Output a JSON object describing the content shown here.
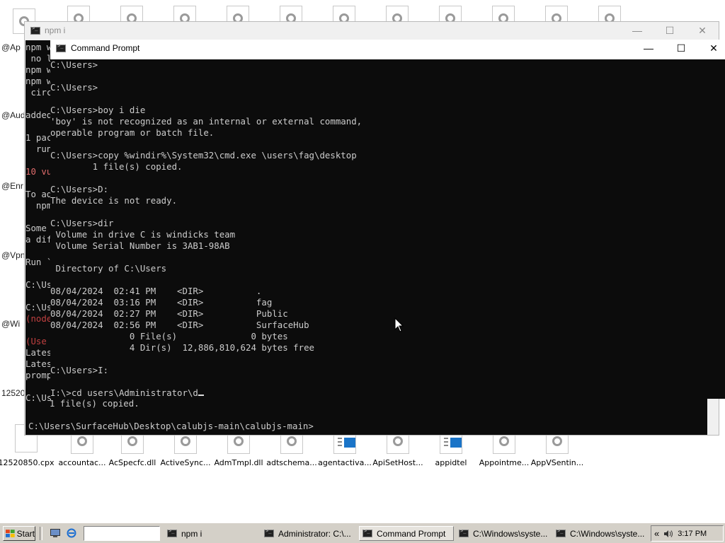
{
  "desktop": {
    "top_icon_count": 11,
    "left_labels": [
      "@Ap",
      "@Aud",
      "@Enr",
      "@Vpn",
      "@Wi",
      "12520/"
    ],
    "bottom_icons": [
      {
        "label": "12520850.cpx",
        "icon": "blank-file-icon"
      },
      {
        "label": "accountac...",
        "icon": "gear-file-icon"
      },
      {
        "label": "AcSpecfc.dll",
        "icon": "gear-file-icon"
      },
      {
        "label": "ActiveSync...",
        "icon": "gear-file-icon"
      },
      {
        "label": "AdmTmpl.dll",
        "icon": "gear-file-icon"
      },
      {
        "label": "adtschema...",
        "icon": "gear-file-icon"
      },
      {
        "label": "agentactiva...",
        "icon": "app-file-icon"
      },
      {
        "label": "ApiSetHost...",
        "icon": "gear-file-icon"
      },
      {
        "label": "appidtel",
        "icon": "app-file-icon"
      },
      {
        "label": "Appointme...",
        "icon": "gear-file-icon"
      },
      {
        "label": "AppVSentin...",
        "icon": "gear-file-icon"
      }
    ]
  },
  "npm_window": {
    "title": "npm i",
    "minimize": "—",
    "maximize": "☐",
    "close": "✕",
    "lines": [
      {
        "text": "npm w",
        "color": "#cccccc"
      },
      {
        "text": " no l",
        "color": "#cccccc"
      },
      {
        "text": "npm w",
        "color": "#cccccc"
      },
      {
        "text": "npm w",
        "color": "#cccccc"
      },
      {
        "text": " circ",
        "color": "#cccccc"
      },
      {
        "text": "",
        "color": "#cccccc"
      },
      {
        "text": "added",
        "color": "#cccccc"
      },
      {
        "text": "",
        "color": "#cccccc"
      },
      {
        "text": "1 pac",
        "color": "#cccccc"
      },
      {
        "text": "  run",
        "color": "#cccccc"
      },
      {
        "text": "",
        "color": "#cccccc"
      },
      {
        "text": "10 vu",
        "color": "#e06c6c"
      },
      {
        "text": "",
        "color": "#cccccc"
      },
      {
        "text": "To ad",
        "color": "#cccccc"
      },
      {
        "text": "  npm",
        "color": "#cccccc"
      },
      {
        "text": "",
        "color": "#cccccc"
      },
      {
        "text": "Some ",
        "color": "#cccccc"
      },
      {
        "text": "a dif",
        "color": "#cccccc"
      },
      {
        "text": "",
        "color": "#cccccc"
      },
      {
        "text": "Run `",
        "color": "#cccccc"
      },
      {
        "text": "",
        "color": "#cccccc"
      },
      {
        "text": "C:\\Us",
        "color": "#cccccc"
      },
      {
        "text": "",
        "color": "#cccccc"
      },
      {
        "text": "C:\\Us",
        "color": "#cccccc"
      },
      {
        "text": "(node",
        "color": "#c04040"
      },
      {
        "text": "",
        "color": "#cccccc"
      },
      {
        "text": "(Use ",
        "color": "#c04040"
      },
      {
        "text": "Lates",
        "color": "#cccccc"
      },
      {
        "text": "Lates",
        "color": "#cccccc"
      },
      {
        "text": "promp",
        "color": "#cccccc"
      },
      {
        "text": "",
        "color": "#cccccc"
      },
      {
        "text": "C:\\Us",
        "color": "#cccccc"
      }
    ],
    "bottom_lines": [
      "    1 file(s) copied.",
      "",
      "C:\\Users\\SurfaceHub\\Desktop\\calubjs-main\\calubjs-main>"
    ]
  },
  "cmd_window": {
    "title": "Command Prompt",
    "minimize": "—",
    "maximize": "☐",
    "close": "✕",
    "lines": [
      "C:\\Users>",
      "",
      "C:\\Users>",
      "",
      "C:\\Users>boy i die",
      "'boy' is not recognized as an internal or external command,",
      "operable program or batch file.",
      "",
      "C:\\Users>copy %windir%\\System32\\cmd.exe \\users\\fag\\desktop",
      "        1 file(s) copied.",
      "",
      "C:\\Users>D:",
      "The device is not ready.",
      "",
      "C:\\Users>dir",
      " Volume in drive C is windicks team",
      " Volume Serial Number is 3AB1-98AB",
      "",
      " Directory of C:\\Users",
      "",
      "08/04/2024  02:41 PM    <DIR>          .",
      "08/04/2024  03:16 PM    <DIR>          fag",
      "08/04/2024  02:27 PM    <DIR>          Public",
      "08/04/2024  02:56 PM    <DIR>          SurfaceHub",
      "               0 File(s)              0 bytes",
      "               4 Dir(s)  12,886,810,624 bytes free",
      "",
      "C:\\Users>I:",
      "",
      "I:\\>cd users\\Administrator\\d"
    ]
  },
  "taskbar": {
    "start_label": "Start",
    "buttons": [
      {
        "label": "npm i",
        "active": false
      },
      {
        "label": "Administrator: C:\\...",
        "active": false
      },
      {
        "label": "Command Prompt",
        "active": true
      },
      {
        "label": "C:\\Windows\\syste...",
        "active": false
      },
      {
        "label": "C:\\Windows\\syste...",
        "active": false
      }
    ],
    "tray_chevron": "«",
    "clock": "3:17 PM"
  }
}
